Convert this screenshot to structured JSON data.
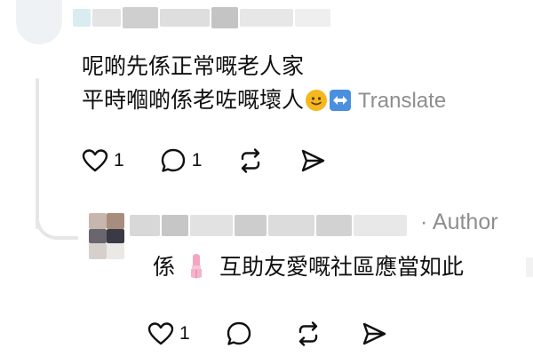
{
  "comment": {
    "text_line1": "呢啲先係正常嘅老人家",
    "text_line2": "平時嗰啲係老咗嘅壞人",
    "translate_label": "Translate",
    "likes": "1",
    "replies": "1"
  },
  "reply": {
    "author_tag": "· Author",
    "text_prefix": "係",
    "text_suffix": "互助友愛嘅社區應當如此",
    "likes": "1"
  },
  "icons": {
    "like": "heart-icon",
    "reply": "comment-bubble-icon",
    "repost": "repost-icon",
    "share": "send-icon",
    "emoji1": "slightly-smiling-face-emoji",
    "emoji2": "left-right-arrow-emoji",
    "emoji3": "lipstick-emoji"
  },
  "colors": {
    "secondary_text": "#8e8e8e",
    "thread_line": "#e6e6e6"
  }
}
